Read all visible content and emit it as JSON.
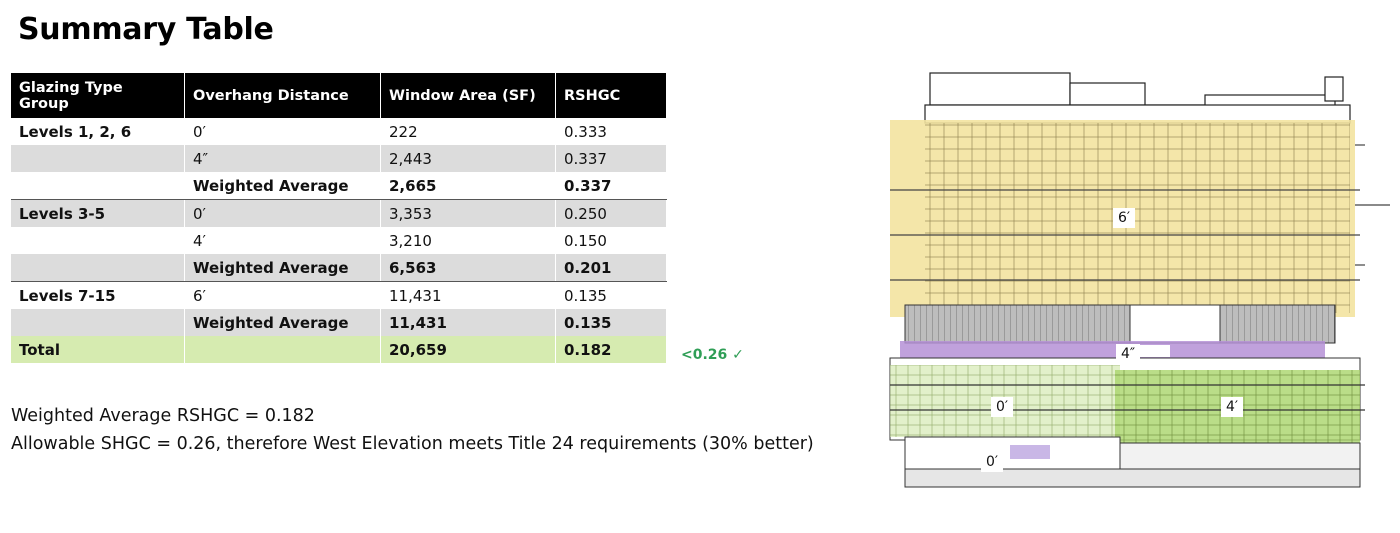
{
  "title": "Summary Table",
  "table": {
    "headers": [
      "Glazing Type Group",
      "Overhang Distance",
      "Window Area (SF)",
      "RSHGC"
    ],
    "rows": [
      {
        "group": "Levels 1, 2, 6",
        "overhang": "0′",
        "area": "222",
        "rshgc": "0.333"
      },
      {
        "group": "",
        "overhang": "4″",
        "area": "2,443",
        "rshgc": "0.337"
      },
      {
        "group": "",
        "overhang": "Weighted Average",
        "area": "2,665",
        "rshgc": "0.337"
      },
      {
        "group": "Levels 3-5",
        "overhang": "0′",
        "area": "3,353",
        "rshgc": "0.250"
      },
      {
        "group": "",
        "overhang": "4′",
        "area": "3,210",
        "rshgc": "0.150"
      },
      {
        "group": "",
        "overhang": "Weighted Average",
        "area": "6,563",
        "rshgc": "0.201"
      },
      {
        "group": "Levels 7-15",
        "overhang": "6′",
        "area": "11,431",
        "rshgc": "0.135"
      },
      {
        "group": "",
        "overhang": "Weighted Average",
        "area": "11,431",
        "rshgc": "0.135"
      }
    ],
    "total": {
      "label": "Total",
      "overhang": "",
      "area": "20,659",
      "rshgc": "0.182"
    }
  },
  "compliance": "<0.26 ✓",
  "notes": {
    "line1": "Weighted Average RSHGC = 0.182",
    "line2": "Allowable SHGC = 0.26, therefore West Elevation meets Title 24 requirements (30% better)"
  },
  "elevation": {
    "labels": {
      "upper": "6′",
      "mid": "4″",
      "lower_left": "0′",
      "lower_right": "4′",
      "ground": "0′"
    },
    "colors": {
      "yellow": "#f3e3a0",
      "purple": "#b591d6",
      "green": "#cfe6a6",
      "green_dark": "#a9d46a"
    }
  }
}
